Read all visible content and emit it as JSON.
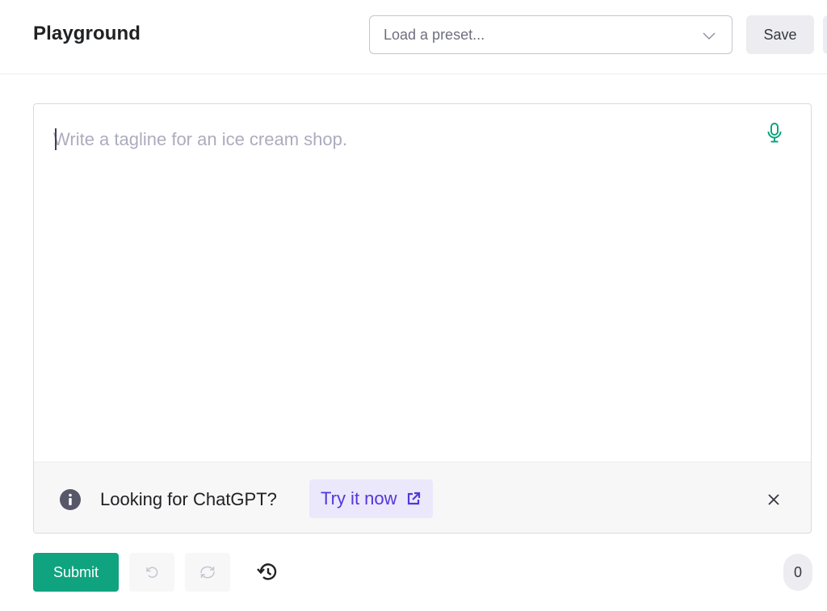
{
  "header": {
    "title": "Playground",
    "preset_placeholder": "Load a preset...",
    "save_label": "Save"
  },
  "editor": {
    "placeholder": "Write a tagline for an ice cream shop.",
    "value": ""
  },
  "banner": {
    "text": "Looking for ChatGPT?",
    "link_label": "Try it now"
  },
  "footer": {
    "submit_label": "Submit",
    "token_count": "0"
  },
  "colors": {
    "accent": "#10a37f",
    "link": "#5436da",
    "link_bg": "#ebe8fb"
  },
  "icons": [
    "chevron-down-icon",
    "microphone-icon",
    "info-icon",
    "external-link-icon",
    "close-icon",
    "undo-icon",
    "redo-icon",
    "history-icon"
  ]
}
